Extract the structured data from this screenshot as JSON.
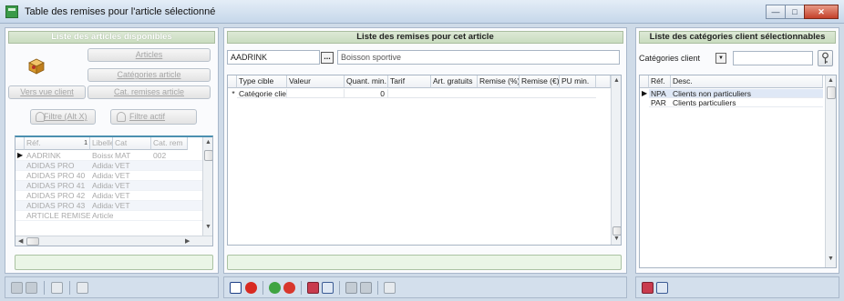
{
  "window": {
    "title": "Table des remises pour l'article sélectionné",
    "buttons": [
      "—",
      "□",
      "✕"
    ]
  },
  "left": {
    "header": "Liste des articles disponibles",
    "buttons": {
      "articles": "Articles",
      "categories_article": "Catégories article",
      "vers_vue_client": "Vers vue client",
      "cat_remises_article": "Cat. remises article",
      "filtre": "Filtre (Alt X)",
      "filtre_actif": "Filtre actif"
    },
    "columns": [
      "Réf.",
      "Libellé",
      "Cat",
      "Cat. rem"
    ],
    "sort_indicator": "1",
    "rows": [
      [
        "AADRINK",
        "Boisson",
        "MAT",
        "002"
      ],
      [
        "ADIDAS PRO",
        "Adidas",
        "VET",
        ""
      ],
      [
        "ADIDAS PRO 40",
        "Adidas",
        "VET",
        ""
      ],
      [
        "ADIDAS PRO 41",
        "Adidas",
        "VET",
        ""
      ],
      [
        "ADIDAS PRO 42",
        "Adidas",
        "VET",
        ""
      ],
      [
        "ADIDAS PRO 43",
        "Adidas",
        "VET",
        ""
      ],
      [
        "ARTICLE REMISE 5",
        "Article",
        "",
        ""
      ]
    ]
  },
  "middle": {
    "header": "Liste des remises pour cet article",
    "article_code": "AADRINK",
    "lookup_button": "...",
    "article_label": "Boisson sportive",
    "columns": [
      "Type cible",
      "Valeur",
      "Quant. min.",
      "Tarif",
      "Art. gratuits",
      "Remise (%)",
      "Remise (€)",
      "PU min."
    ],
    "new_row_marker": "*",
    "new_row": {
      "type_cible": "Catégorie client",
      "quant_min": "0"
    }
  },
  "right": {
    "header": "Liste des catégories client sélectionnables",
    "filter_label": "Catégories client",
    "filter_value": "",
    "columns": [
      "Réf.",
      "Desc."
    ],
    "rows": [
      [
        "NPA",
        "Clients non particuliers"
      ],
      [
        "PAR",
        "Clients particuliers"
      ]
    ]
  },
  "colors": {
    "title_bg": "#c6d7ea",
    "header_green": "#c9dcbf",
    "selected_row": "#dfe8f6",
    "close_red": "#c4402a"
  },
  "icons": [
    "app-icon",
    "article-box-icon",
    "filter-icon",
    "filter-active-icon",
    "save-icon",
    "cancel-icon",
    "key-icon",
    "dropdown-icon"
  ]
}
